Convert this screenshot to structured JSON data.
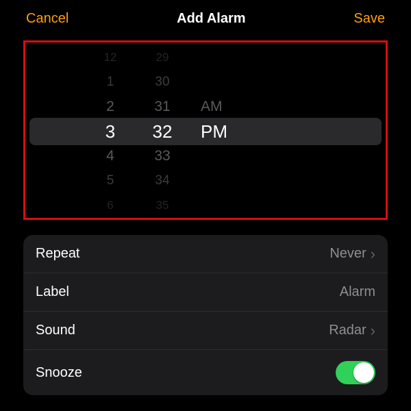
{
  "navbar": {
    "cancel": "Cancel",
    "title": "Add Alarm",
    "save": "Save"
  },
  "picker": {
    "hours": {
      "m3": "12",
      "m2": "1",
      "m1": "2",
      "sel": "3",
      "p1": "4",
      "p2": "5",
      "p3": "6"
    },
    "minutes": {
      "m3": "29",
      "m2": "30",
      "m1": "31",
      "sel": "32",
      "p1": "33",
      "p2": "34",
      "p3": "35"
    },
    "period": {
      "am": "AM",
      "pm": "PM",
      "selected": "PM"
    }
  },
  "settings": {
    "repeat": {
      "label": "Repeat",
      "value": "Never"
    },
    "label": {
      "label": "Label",
      "value": "Alarm"
    },
    "sound": {
      "label": "Sound",
      "value": "Radar"
    },
    "snooze": {
      "label": "Snooze",
      "on": true
    }
  }
}
